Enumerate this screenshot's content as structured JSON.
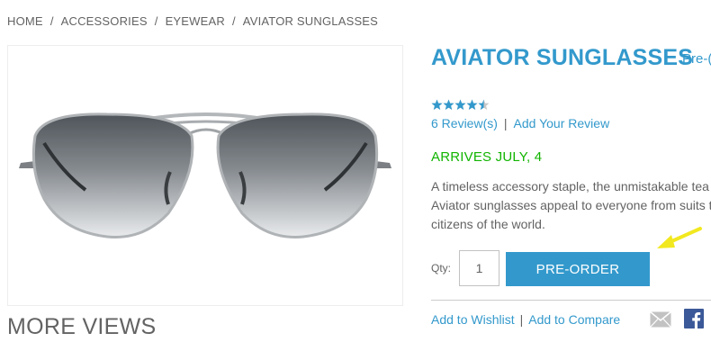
{
  "breadcrumb": {
    "items": [
      "HOME",
      "ACCESSORIES",
      "EYEWEAR",
      "AVIATOR SUNGLASSES"
    ],
    "separator": "/"
  },
  "gallery": {
    "image_icon": "aviator-sunglasses-photo",
    "more_views_heading": "MORE VIEWS"
  },
  "product": {
    "title": "AVIATOR SUNGLASSES",
    "preorder_tag": "Pre-(",
    "rating": {
      "value": 4.5,
      "max": 5,
      "color": "#3399cc"
    },
    "reviews_link": "6 Review(s)",
    "review_separator": "|",
    "add_review_link": "Add Your Review",
    "arrival": "ARRIVES JULY, 4",
    "description_lines": [
      "A timeless accessory staple, the unmistakable tea",
      "Aviator sunglasses appeal to everyone from suits t",
      "citizens of the world."
    ]
  },
  "purchase": {
    "qty_label": "Qty:",
    "qty_value": "1",
    "preorder_button": "PRE-ORDER"
  },
  "actions": {
    "wishlist_link": "Add to Wishlist",
    "separator": "|",
    "compare_link": "Add to Compare",
    "email_icon": "envelope-icon",
    "facebook_icon": "facebook-icon"
  },
  "colors": {
    "accent": "#3399cc",
    "arrival_green": "#11b400",
    "text": "#636363",
    "annotation_arrow": "#f2e81f"
  }
}
